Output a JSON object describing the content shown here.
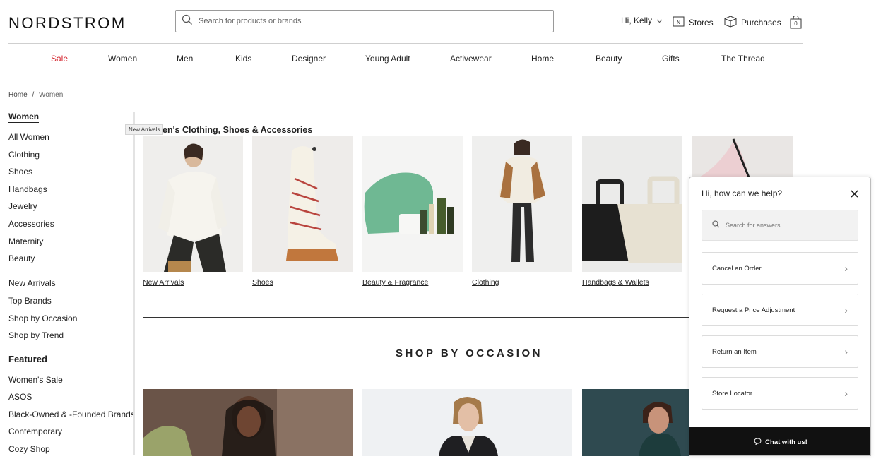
{
  "brand": {
    "logo": "NORDSTROM"
  },
  "search": {
    "placeholder": "Search for products or brands"
  },
  "header": {
    "greeting": "Hi, Kelly",
    "stores": "Stores",
    "purchases": "Purchases",
    "bag_count": "0"
  },
  "topnav": [
    "Sale",
    "Women",
    "Men",
    "Kids",
    "Designer",
    "Young Adult",
    "Activewear",
    "Home",
    "Beauty",
    "Gifts",
    "The Thread"
  ],
  "colors": {
    "sale": "#d6262f",
    "chat_bar": "#111111"
  },
  "breadcrumb": {
    "home": "Home",
    "sep": "/",
    "current": "Women"
  },
  "sidebar": {
    "heading": "Women",
    "items": [
      "All Women",
      "Clothing",
      "Shoes",
      "Handbags",
      "Jewelry",
      "Accessories",
      "Maternity",
      "Beauty"
    ],
    "items2": [
      "New Arrivals",
      "Top Brands",
      "Shop by Occasion",
      "Shop by Trend"
    ],
    "featured_heading": "Featured",
    "featured": [
      "Women's Sale",
      "ASOS",
      "Black-Owned & -Founded Brands",
      "Contemporary",
      "Cozy Shop"
    ]
  },
  "tooltip": "New Arrivals",
  "section": {
    "title": "en's Clothing, Shoes & Accessories"
  },
  "categories": [
    "New Arrivals",
    "Shoes",
    "Beauty & Fragrance",
    "Clothing",
    "Handbags & Wallets"
  ],
  "occasion": {
    "title": "SHOP BY OCCASION"
  },
  "help": {
    "title": "Hi, how can we help?",
    "search_placeholder": "Search for answers",
    "options": [
      "Cancel an Order",
      "Request a Price Adjustment",
      "Return an Item",
      "Store Locator"
    ],
    "chat": "Chat with us!"
  }
}
